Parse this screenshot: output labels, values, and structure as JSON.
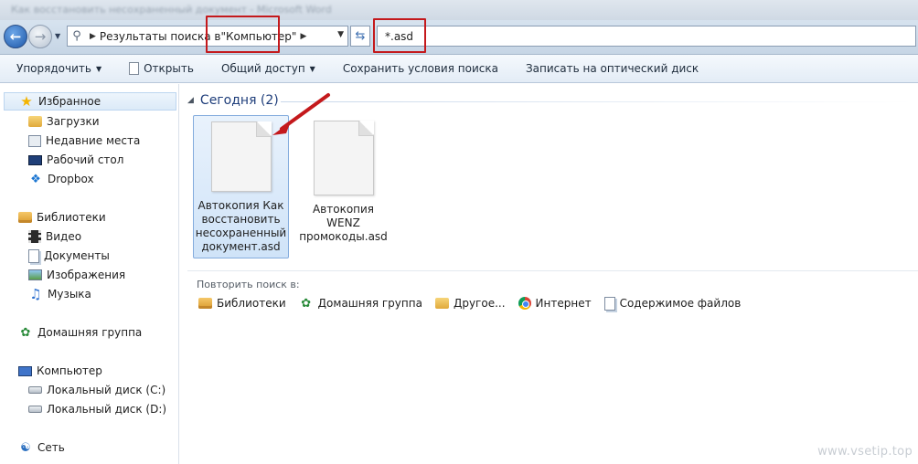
{
  "window": {
    "title_blurred": "Как восстановить несохраненный документ - Microsoft Word"
  },
  "address": {
    "crumb_prefix": "Результаты поиска в",
    "crumb_location": "\"Компьютер\""
  },
  "search": {
    "query": "*.asd"
  },
  "toolbar": {
    "organize": "Упорядочить",
    "open": "Открыть",
    "share": "Общий доступ",
    "save_search": "Сохранить условия поиска",
    "burn": "Записать на оптический диск"
  },
  "sidebar": {
    "favorites": "Избранное",
    "downloads": "Загрузки",
    "recent": "Недавние места",
    "desktop": "Рабочий стол",
    "dropbox": "Dropbox",
    "libraries": "Библиотеки",
    "video": "Видео",
    "documents": "Документы",
    "pictures": "Изображения",
    "music": "Музыка",
    "homegroup": "Домашняя группа",
    "computer": "Компьютер",
    "drive_c": "Локальный диск (C:)",
    "drive_d": "Локальный диск (D:)",
    "network": "Сеть"
  },
  "results": {
    "group_label": "Сегодня (2)",
    "files": [
      {
        "name_line1": "Автокопия Как",
        "name_line2": "восстановить",
        "name_line3": "несохраненный",
        "name_line4": "документ.asd"
      },
      {
        "name_line1": "Автокопия",
        "name_line2": "WENZ",
        "name_line3": "промокоды.asd"
      }
    ]
  },
  "retry": {
    "label": "Повторить поиск в:",
    "libraries": "Библиотеки",
    "homegroup": "Домашняя группа",
    "other": "Другое...",
    "internet": "Интернет",
    "file_contents": "Содержимое файлов"
  },
  "watermark": "www.vsetip.top",
  "colors": {
    "highlight_red": "#c4191c",
    "group_blue": "#1e3d7a",
    "selection": "#cfe3f8"
  }
}
